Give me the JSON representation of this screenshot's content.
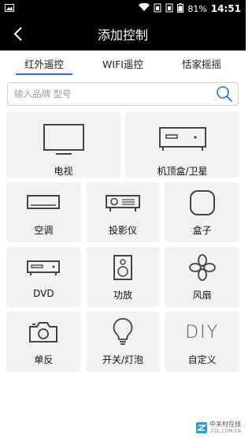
{
  "status": {
    "battery": "81%",
    "time": "14:51"
  },
  "header": {
    "title": "添加控制"
  },
  "tabs": [
    {
      "label": "红外遥控",
      "active": true
    },
    {
      "label": "WIFI遥控",
      "active": false
    },
    {
      "label": "恬家摇摇",
      "active": false
    }
  ],
  "search": {
    "placeholder": "输入品牌 型号",
    "value": ""
  },
  "devices": {
    "tv": "电视",
    "stb": "机顶盒/卫星",
    "ac": "空调",
    "projector": "投影仪",
    "box": "盒子",
    "dvd": "DVD",
    "amp": "功放",
    "fan": "风扇",
    "camera": "单反",
    "light": "开关/灯泡",
    "diy": "自定义",
    "diy_glyph": "DIY"
  },
  "watermark": {
    "text": "中关村在线",
    "sub": "ZOL.COM.CN"
  },
  "colors": {
    "accent": "#2a6fdb",
    "bar": "#000000",
    "card": "#f2f2f2"
  }
}
